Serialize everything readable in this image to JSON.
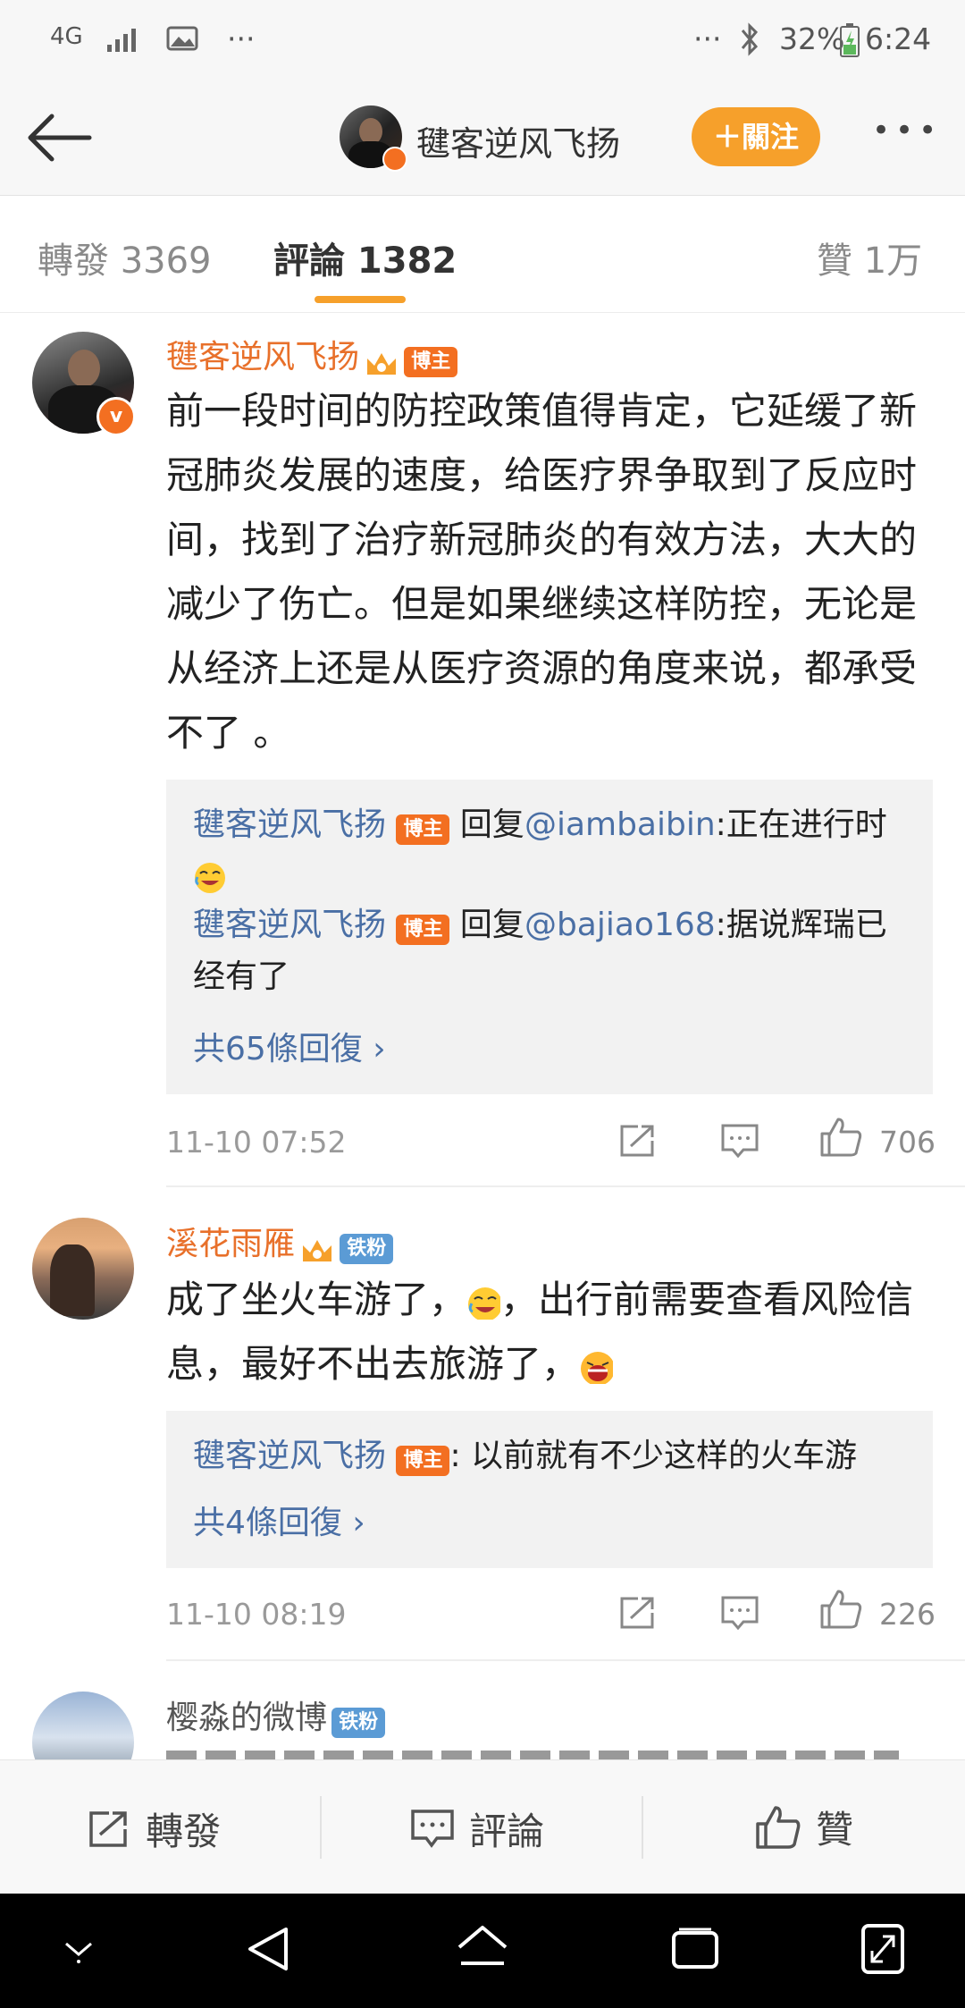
{
  "status_bar": {
    "network": "4G",
    "dots_left": "···",
    "dots_right": "···",
    "battery": "32%",
    "time": "6:24"
  },
  "header": {
    "author_name": "毽客逆风飞扬",
    "follow_label": "＋關注",
    "menu_label": "•••"
  },
  "tabs": {
    "repost": "轉發 3369",
    "comment": "評論 1382",
    "like": "贊 1万"
  },
  "comments": [
    {
      "author": "毽客逆风飞扬",
      "badge": "博主",
      "text": "  前一段时间的防控政策值得肯定，它延缓了新冠肺炎发展的速度，给医疗界争取到了反应时间，找到了治疗新冠肺炎的有效方法，大大的减少了伤亡。但是如果继续这样防控，无论是从经济上还是从医疗资源的角度来说，都承受不了 。",
      "replies": [
        {
          "name": "毽客逆风飞扬",
          "badge": "博主",
          "verb": " 回复",
          "mention": "@iambaibin",
          "text": ":正在进行时"
        },
        {
          "name": "毽客逆风飞扬",
          "badge": "博主",
          "verb": " 回复",
          "mention": "@bajiao168",
          "text": ":据说辉瑞已经有了"
        }
      ],
      "more": "共65條回復 ›",
      "date": "11-10 07:52",
      "likes": "706"
    },
    {
      "author": "溪花雨雁",
      "badge": "铁粉",
      "text_a": "成了坐火车游了，",
      "text_b": "，出行前需要查看风险信息，最好不出去旅游了，",
      "replies": [
        {
          "name": "毽客逆风飞扬",
          "badge": "博主",
          "text": ": 以前就有不少这样的火车游"
        }
      ],
      "more": "共4條回復 ›",
      "date": "11-10 08:19",
      "likes": "226"
    },
    {
      "author": "樱淼的微博",
      "badge": "铁粉"
    }
  ],
  "bottom_bar": {
    "repost": "轉發",
    "comment": "評論",
    "like": "贊"
  },
  "colors": {
    "accent_orange": "#f6a02b",
    "author_orange": "#e8702a",
    "link_blue": "#4a6fa5",
    "tab_underline": "#f6a02b"
  }
}
